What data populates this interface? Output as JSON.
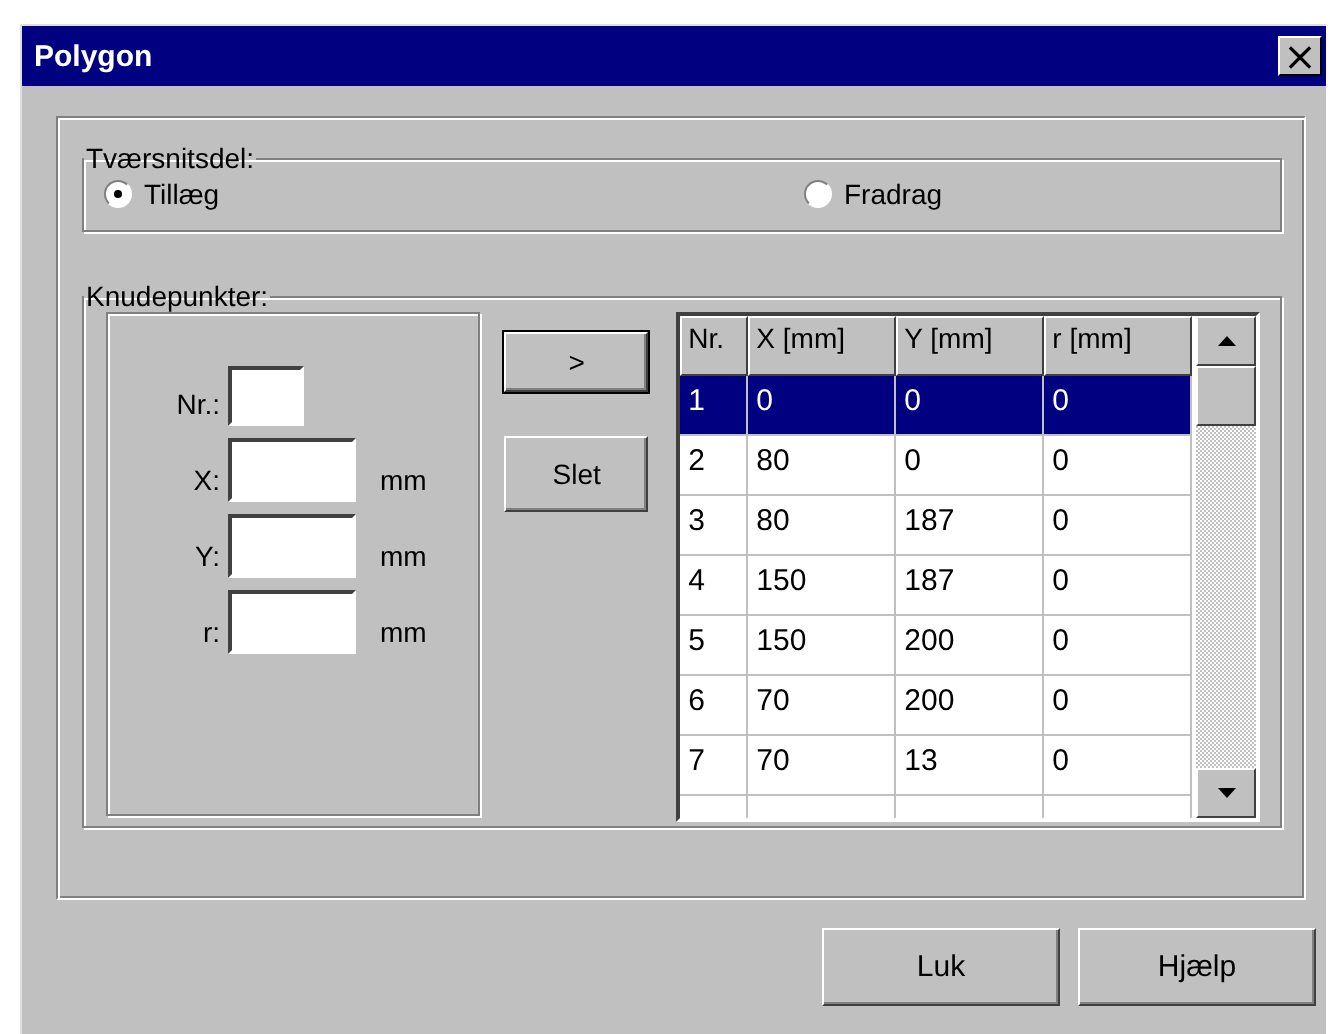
{
  "window": {
    "title": "Polygon",
    "close": "×"
  },
  "section": {
    "title": "Tværsnitsdel:",
    "options": [
      {
        "label": "Tillæg",
        "selected": true
      },
      {
        "label": "Fradrag",
        "selected": false
      }
    ]
  },
  "nodes": {
    "title": "Knudepunkter:",
    "fields": [
      {
        "label": "Nr.:",
        "kind": "short"
      },
      {
        "label": "X:",
        "unit": "mm",
        "kind": "long"
      },
      {
        "label": "Y:",
        "unit": "mm",
        "kind": "long"
      },
      {
        "label": "r:",
        "unit": "mm",
        "kind": "long"
      }
    ],
    "buttons": [
      {
        "label": ">",
        "default": true
      },
      {
        "label": "Slet",
        "default": false
      }
    ],
    "table": {
      "columns": [
        "Nr.",
        "X [mm]",
        "Y [mm]",
        "r [mm]"
      ],
      "rows": [
        {
          "cells": [
            "1",
            "0",
            "0",
            "0"
          ],
          "selected": true
        },
        {
          "cells": [
            "2",
            "80",
            "0",
            "0"
          ],
          "selected": false
        },
        {
          "cells": [
            "3",
            "80",
            "187",
            "0"
          ],
          "selected": false
        },
        {
          "cells": [
            "4",
            "150",
            "187",
            "0"
          ],
          "selected": false
        },
        {
          "cells": [
            "5",
            "150",
            "200",
            "0"
          ],
          "selected": false
        },
        {
          "cells": [
            "6",
            "70",
            "200",
            "0"
          ],
          "selected": false
        },
        {
          "cells": [
            "7",
            "70",
            "13",
            "0"
          ],
          "selected": false
        }
      ]
    }
  },
  "buttons": [
    "Luk",
    "Hjælp"
  ]
}
